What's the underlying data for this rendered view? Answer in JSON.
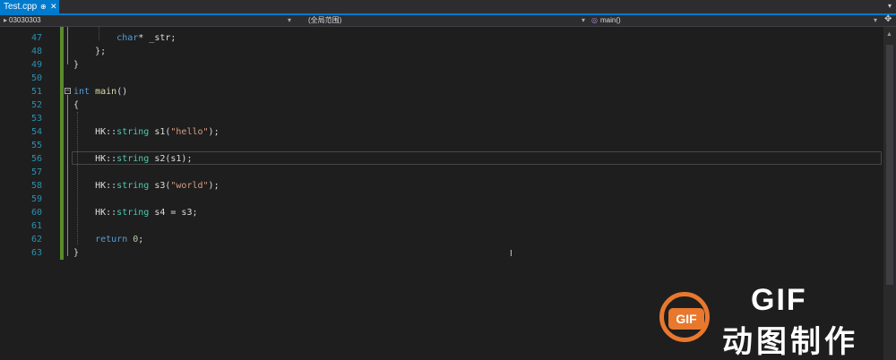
{
  "tab": {
    "filename": "Test.cpp",
    "pin": "⊕",
    "close": "✕"
  },
  "navbar": {
    "project": "03030303",
    "scope": "(全局范围)",
    "function": "main()",
    "dropdown_arrow": "▾"
  },
  "editor": {
    "lines": [
      {
        "num": "47",
        "code": [
          {
            "t": "        ",
            "c": ""
          },
          {
            "t": "char",
            "c": "kw"
          },
          {
            "t": "* _str;",
            "c": ""
          }
        ]
      },
      {
        "num": "48",
        "code": [
          {
            "t": "    };",
            "c": ""
          }
        ]
      },
      {
        "num": "49",
        "code": [
          {
            "t": "}",
            "c": ""
          }
        ]
      },
      {
        "num": "50",
        "code": []
      },
      {
        "num": "51",
        "code": [
          {
            "t": "int",
            "c": "kw"
          },
          {
            "t": " ",
            "c": ""
          },
          {
            "t": "main",
            "c": "fn"
          },
          {
            "t": "()",
            "c": ""
          }
        ]
      },
      {
        "num": "52",
        "code": [
          {
            "t": "{",
            "c": ""
          }
        ]
      },
      {
        "num": "53",
        "code": []
      },
      {
        "num": "54",
        "code": [
          {
            "t": "    HK::",
            "c": ""
          },
          {
            "t": "string",
            "c": "ty"
          },
          {
            "t": " s1(",
            "c": ""
          },
          {
            "t": "\"hello\"",
            "c": "str"
          },
          {
            "t": ");",
            "c": ""
          }
        ]
      },
      {
        "num": "55",
        "code": []
      },
      {
        "num": "56",
        "code": [
          {
            "t": "    HK::",
            "c": ""
          },
          {
            "t": "string",
            "c": "ty"
          },
          {
            "t": " s2(s1);",
            "c": ""
          }
        ]
      },
      {
        "num": "57",
        "code": []
      },
      {
        "num": "58",
        "code": [
          {
            "t": "    HK::",
            "c": ""
          },
          {
            "t": "string",
            "c": "ty"
          },
          {
            "t": " s3(",
            "c": ""
          },
          {
            "t": "\"world\"",
            "c": "str"
          },
          {
            "t": ");",
            "c": ""
          }
        ]
      },
      {
        "num": "59",
        "code": []
      },
      {
        "num": "60",
        "code": [
          {
            "t": "    HK::",
            "c": ""
          },
          {
            "t": "string",
            "c": "ty"
          },
          {
            "t": " s4 = s3;",
            "c": ""
          }
        ]
      },
      {
        "num": "61",
        "code": []
      },
      {
        "num": "62",
        "code": [
          {
            "t": "    ",
            "c": ""
          },
          {
            "t": "return",
            "c": "kw"
          },
          {
            "t": " ",
            "c": ""
          },
          {
            "t": "0",
            "c": "num"
          },
          {
            "t": ";",
            "c": ""
          }
        ]
      },
      {
        "num": "63",
        "code": [
          {
            "t": "}",
            "c": ""
          }
        ]
      }
    ]
  },
  "watermark": {
    "badge": "GIF",
    "title": "GIF",
    "subtitle": "动图制作"
  },
  "colors": {
    "accent": "#007acc",
    "keyword": "#569cd6",
    "type": "#4ec9b0",
    "string": "#d69d85",
    "line_number": "#2b91af",
    "watermark_orange": "#e8782e"
  }
}
